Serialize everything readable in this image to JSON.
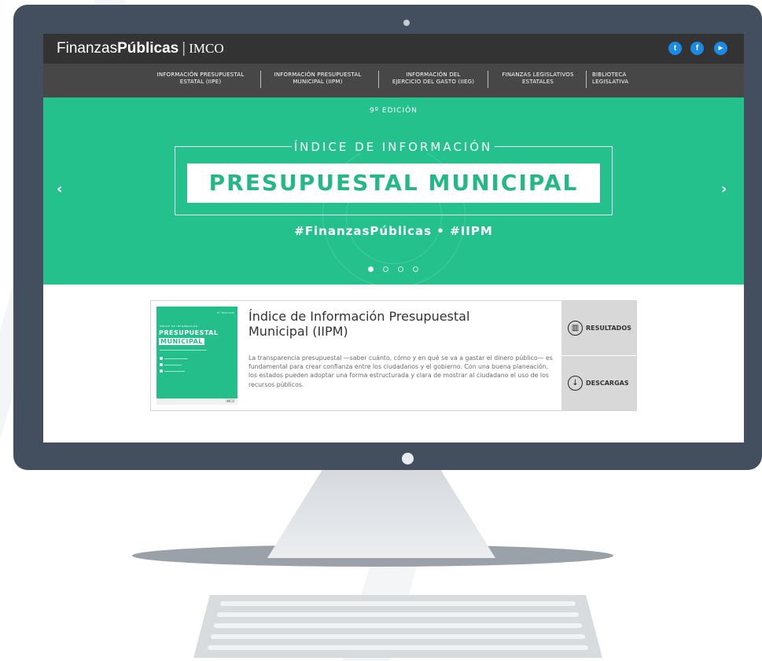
{
  "header": {
    "brand_part1": "Finanzas",
    "brand_part2": "Públicas",
    "brand_separator": "|",
    "brand_partner": "IMCO",
    "social": [
      {
        "name": "twitter-icon",
        "glyph": "t"
      },
      {
        "name": "facebook-icon",
        "glyph": "f"
      },
      {
        "name": "youtube-icon",
        "glyph": "▶"
      }
    ]
  },
  "nav": {
    "items": [
      {
        "line1": "INFORMACIÓN PRESUPUESTAL",
        "line2": "ESTATAL (IIPE)"
      },
      {
        "line1": "INFORMACIÓN PRESUPUESTAL",
        "line2": "MUNICIPAL (IIPM)"
      },
      {
        "line1": "INFORMACIÓN DEL",
        "line2": "EJERCICIO DEL GASTO (IIEG)"
      },
      {
        "line1": "FINANZAS LEGISLATIVOS",
        "line2": "ESTATALES"
      },
      {
        "line1": "BIBLIOTECA",
        "line2": "LEGISLATIVA"
      }
    ]
  },
  "hero": {
    "edition": "9º EDICIÓN",
    "kicker": "ÍNDICE DE INFORMACIÓN",
    "title": "PRESUPUESTAL MUNICIPAL",
    "hashtags": "#FinanzasPúblicas • #IIPM",
    "prev_arrow": "‹",
    "next_arrow": "›",
    "slides_total": 4,
    "active_slide": 1
  },
  "card": {
    "cover": {
      "edition": "9º EDICIÓN",
      "kicker": "ÍNDICE DE INFORMACIÓN",
      "title_line1": "PRESUPUESTAL",
      "title_line2": "MUNICIPAL",
      "logo": "IMCO"
    },
    "title": "Índice de Información Presupuestal Municipal (IIPM)",
    "description": "La transparencia presupuestal —saber cuánto, cómo y en qué se va a gastar el dinero público— es fundamental para crear confianza entre los ciudadanos y el gobierno. Con una buena planeación, los estados pueden adoptar una forma estructurada y clara de mostrar al ciudadano el uso de los recursos públicos.",
    "results_label": "RESULTADOS",
    "downloads_label": "DESCARGAS"
  },
  "colors": {
    "hero_green": "#25c18d",
    "topbar": "#333333",
    "navbar": "#474747",
    "monitor_frame": "#434f5e",
    "social_blue": "#1a8ae5"
  }
}
